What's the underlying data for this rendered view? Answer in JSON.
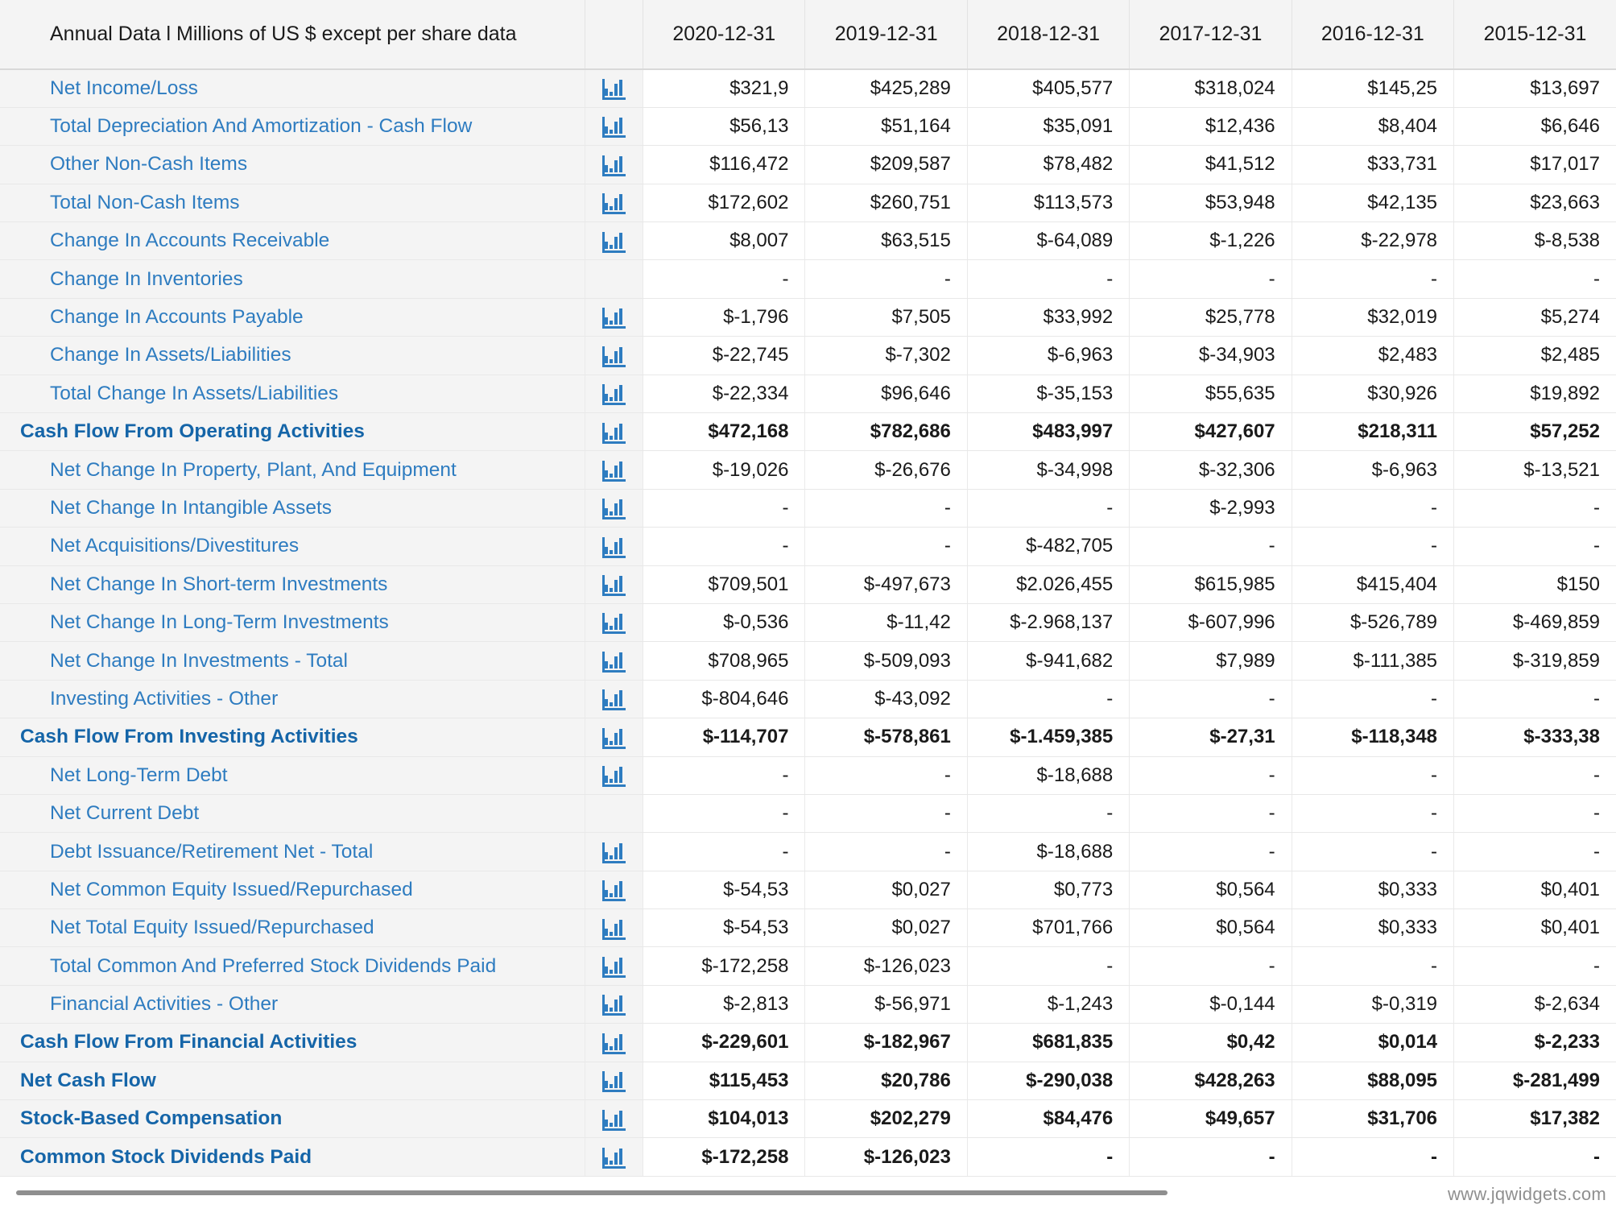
{
  "header": {
    "label": "Annual Data l Millions of US $ except per share data",
    "chart_col": "",
    "years": [
      "2020-12-31",
      "2019-12-31",
      "2018-12-31",
      "2017-12-31",
      "2016-12-31",
      "2015-12-31"
    ]
  },
  "footer": {
    "watermark": "www.jqwidgets.com"
  },
  "icons": {
    "chart": "bar-chart-icon"
  },
  "colors": {
    "link": "#2e7cc0",
    "bold_link": "#1565a8",
    "label_bg": "#f4f4f4",
    "value_bg": "#ffffff",
    "border": "#e8e8e8"
  },
  "chart_data": {
    "type": "table",
    "title": "Annual Data l Millions of US $ except per share data",
    "categories": [
      "2020-12-31",
      "2019-12-31",
      "2018-12-31",
      "2017-12-31",
      "2016-12-31",
      "2015-12-31"
    ],
    "rows": [
      {
        "label": "Net Income/Loss",
        "bold": false,
        "chart": true,
        "values": [
          "$321,9",
          "$425,289",
          "$405,577",
          "$318,024",
          "$145,25",
          "$13,697"
        ]
      },
      {
        "label": "Total Depreciation And Amortization - Cash Flow",
        "bold": false,
        "chart": true,
        "values": [
          "$56,13",
          "$51,164",
          "$35,091",
          "$12,436",
          "$8,404",
          "$6,646"
        ]
      },
      {
        "label": "Other Non-Cash Items",
        "bold": false,
        "chart": true,
        "values": [
          "$116,472",
          "$209,587",
          "$78,482",
          "$41,512",
          "$33,731",
          "$17,017"
        ]
      },
      {
        "label": "Total Non-Cash Items",
        "bold": false,
        "chart": true,
        "values": [
          "$172,602",
          "$260,751",
          "$113,573",
          "$53,948",
          "$42,135",
          "$23,663"
        ]
      },
      {
        "label": "Change In Accounts Receivable",
        "bold": false,
        "chart": true,
        "values": [
          "$8,007",
          "$63,515",
          "$-64,089",
          "$-1,226",
          "$-22,978",
          "$-8,538"
        ]
      },
      {
        "label": "Change In Inventories",
        "bold": false,
        "chart": false,
        "values": [
          "-",
          "-",
          "-",
          "-",
          "-",
          "-"
        ]
      },
      {
        "label": "Change In Accounts Payable",
        "bold": false,
        "chart": true,
        "values": [
          "$-1,796",
          "$7,505",
          "$33,992",
          "$25,778",
          "$32,019",
          "$5,274"
        ]
      },
      {
        "label": "Change In Assets/Liabilities",
        "bold": false,
        "chart": true,
        "values": [
          "$-22,745",
          "$-7,302",
          "$-6,963",
          "$-34,903",
          "$2,483",
          "$2,485"
        ]
      },
      {
        "label": "Total Change In Assets/Liabilities",
        "bold": false,
        "chart": true,
        "values": [
          "$-22,334",
          "$96,646",
          "$-35,153",
          "$55,635",
          "$30,926",
          "$19,892"
        ]
      },
      {
        "label": "Cash Flow From Operating Activities",
        "bold": true,
        "chart": true,
        "values": [
          "$472,168",
          "$782,686",
          "$483,997",
          "$427,607",
          "$218,311",
          "$57,252"
        ]
      },
      {
        "label": "Net Change In Property, Plant, And Equipment",
        "bold": false,
        "chart": true,
        "values": [
          "$-19,026",
          "$-26,676",
          "$-34,998",
          "$-32,306",
          "$-6,963",
          "$-13,521"
        ]
      },
      {
        "label": "Net Change In Intangible Assets",
        "bold": false,
        "chart": true,
        "values": [
          "-",
          "-",
          "-",
          "$-2,993",
          "-",
          "-"
        ]
      },
      {
        "label": "Net Acquisitions/Divestitures",
        "bold": false,
        "chart": true,
        "values": [
          "-",
          "-",
          "$-482,705",
          "-",
          "-",
          "-"
        ]
      },
      {
        "label": "Net Change In Short-term Investments",
        "bold": false,
        "chart": true,
        "values": [
          "$709,501",
          "$-497,673",
          "$2.026,455",
          "$615,985",
          "$415,404",
          "$150"
        ]
      },
      {
        "label": "Net Change In Long-Term Investments",
        "bold": false,
        "chart": true,
        "values": [
          "$-0,536",
          "$-11,42",
          "$-2.968,137",
          "$-607,996",
          "$-526,789",
          "$-469,859"
        ]
      },
      {
        "label": "Net Change In Investments - Total",
        "bold": false,
        "chart": true,
        "values": [
          "$708,965",
          "$-509,093",
          "$-941,682",
          "$7,989",
          "$-111,385",
          "$-319,859"
        ]
      },
      {
        "label": "Investing Activities - Other",
        "bold": false,
        "chart": true,
        "values": [
          "$-804,646",
          "$-43,092",
          "-",
          "-",
          "-",
          "-"
        ]
      },
      {
        "label": "Cash Flow From Investing Activities",
        "bold": true,
        "chart": true,
        "values": [
          "$-114,707",
          "$-578,861",
          "$-1.459,385",
          "$-27,31",
          "$-118,348",
          "$-333,38"
        ]
      },
      {
        "label": "Net Long-Term Debt",
        "bold": false,
        "chart": true,
        "values": [
          "-",
          "-",
          "$-18,688",
          "-",
          "-",
          "-"
        ]
      },
      {
        "label": "Net Current Debt",
        "bold": false,
        "chart": false,
        "values": [
          "-",
          "-",
          "-",
          "-",
          "-",
          "-"
        ]
      },
      {
        "label": "Debt Issuance/Retirement Net - Total",
        "bold": false,
        "chart": true,
        "values": [
          "-",
          "-",
          "$-18,688",
          "-",
          "-",
          "-"
        ]
      },
      {
        "label": "Net Common Equity Issued/Repurchased",
        "bold": false,
        "chart": true,
        "values": [
          "$-54,53",
          "$0,027",
          "$0,773",
          "$0,564",
          "$0,333",
          "$0,401"
        ]
      },
      {
        "label": "Net Total Equity Issued/Repurchased",
        "bold": false,
        "chart": true,
        "values": [
          "$-54,53",
          "$0,027",
          "$701,766",
          "$0,564",
          "$0,333",
          "$0,401"
        ]
      },
      {
        "label": "Total Common And Preferred Stock Dividends Paid",
        "bold": false,
        "chart": true,
        "values": [
          "$-172,258",
          "$-126,023",
          "-",
          "-",
          "-",
          "-"
        ]
      },
      {
        "label": "Financial Activities - Other",
        "bold": false,
        "chart": true,
        "values": [
          "$-2,813",
          "$-56,971",
          "$-1,243",
          "$-0,144",
          "$-0,319",
          "$-2,634"
        ]
      },
      {
        "label": "Cash Flow From Financial Activities",
        "bold": true,
        "chart": true,
        "values": [
          "$-229,601",
          "$-182,967",
          "$681,835",
          "$0,42",
          "$0,014",
          "$-2,233"
        ]
      },
      {
        "label": "Net Cash Flow",
        "bold": true,
        "chart": true,
        "values": [
          "$115,453",
          "$20,786",
          "$-290,038",
          "$428,263",
          "$88,095",
          "$-281,499"
        ]
      },
      {
        "label": "Stock-Based Compensation",
        "bold": true,
        "chart": true,
        "values": [
          "$104,013",
          "$202,279",
          "$84,476",
          "$49,657",
          "$31,706",
          "$17,382"
        ]
      },
      {
        "label": "Common Stock Dividends Paid",
        "bold": true,
        "chart": true,
        "values": [
          "$-172,258",
          "$-126,023",
          "-",
          "-",
          "-",
          "-"
        ]
      }
    ]
  }
}
